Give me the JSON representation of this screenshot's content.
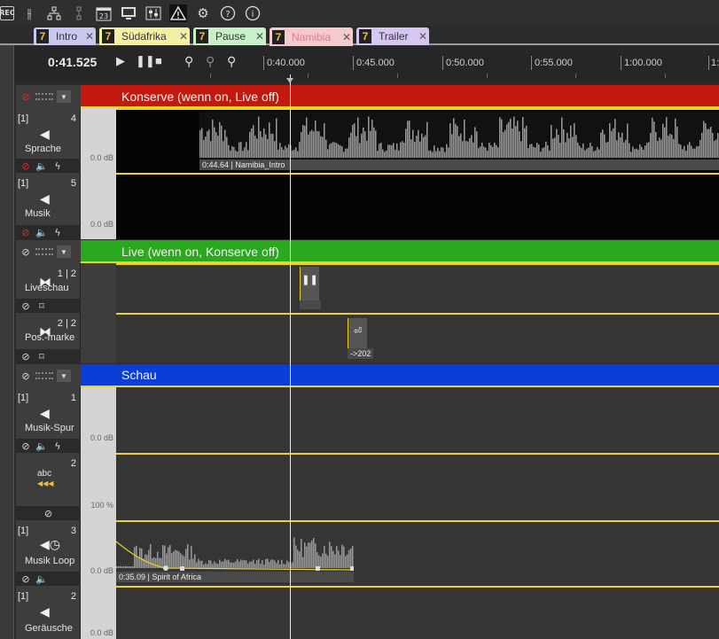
{
  "toolbar": {
    "rec_label": "REC",
    "calendar_day": "23"
  },
  "tabs": [
    {
      "num": "7",
      "label": "Intro",
      "color": "#c9c9ef"
    },
    {
      "num": "7",
      "label": "Südafrika",
      "color": "#f3f0a6"
    },
    {
      "num": "7",
      "label": "Pause",
      "color": "#c9f0c9"
    },
    {
      "num": "7",
      "label": "Namibia",
      "color": "#f6c9cf",
      "active": true
    },
    {
      "num": "7",
      "label": "Trailer",
      "color": "#d6c7f2"
    }
  ],
  "transport": {
    "time": "0:41.525",
    "ruler": [
      "0:40.000",
      "0:45.000",
      "0:50.000",
      "0:55.000",
      "1:00.000",
      "1:"
    ]
  },
  "groups": {
    "konserve": {
      "title": "Konserve (wenn on, Live off)",
      "color": "#c21a0e"
    },
    "live": {
      "title": "Live (wenn on, Konserve off)",
      "color": "#2aa81e"
    },
    "schau": {
      "title": "Schau",
      "color": "#0b3ed6"
    }
  },
  "tracks": {
    "sprache": {
      "bracket": "[1]",
      "index": "4",
      "name": "Sprache",
      "level": "0.0 dB",
      "clip_label": "0:44.64 | Namibia_Intro"
    },
    "musik": {
      "bracket": "[1]",
      "index": "5",
      "name": "Musik",
      "level": "0.0 dB"
    },
    "liveschau": {
      "index": "1 | 2",
      "name": "Liveschau"
    },
    "posmarke": {
      "index": "2 | 2",
      "name": "Pos.-marke",
      "marker_label": "->202"
    },
    "musikspur": {
      "bracket": "[1]",
      "index": "1",
      "name": "Musik-Spur",
      "level": "0.0 dB"
    },
    "abc": {
      "index": "2",
      "name": "abc",
      "level": "100 %"
    },
    "musikloop": {
      "bracket": "[1]",
      "index": "3",
      "name": "Musik Loop",
      "level": "0.0 dB",
      "clip_label": "0:35.09 | Spirit of Africa"
    },
    "geraeusche": {
      "bracket": "[1]",
      "index": "2",
      "name": "Geräusche",
      "level": "0.0 dB"
    }
  }
}
